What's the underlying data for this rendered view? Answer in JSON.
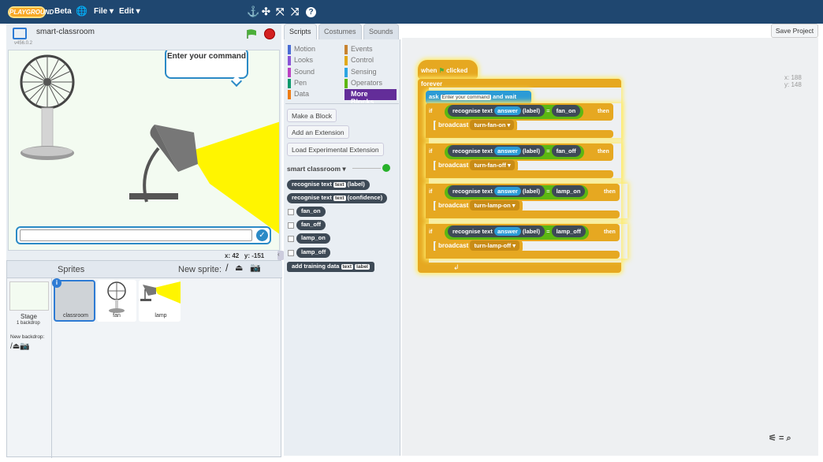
{
  "app": {
    "logo": "PLAYGROUND",
    "beta": "Beta",
    "file": "File ▾",
    "edit": "Edit ▾",
    "version": "v456.0.2"
  },
  "stage": {
    "title": "smart-classroom",
    "speech": "Enter your command",
    "coords_x": "x: 42",
    "coords_y": "y: -151"
  },
  "sprites": {
    "header": "Sprites",
    "new_sprite": "New sprite:",
    "stage_label": "Stage",
    "stage_sub": "1 backdrop",
    "new_backdrop": "New backdrop:",
    "items": [
      {
        "name": "classroom"
      },
      {
        "name": "fan"
      },
      {
        "name": "lamp"
      }
    ]
  },
  "tabs": [
    "Scripts",
    "Costumes",
    "Sounds"
  ],
  "categories": [
    {
      "label": "Motion",
      "color": "#4a6cd4"
    },
    {
      "label": "Events",
      "color": "#c88330"
    },
    {
      "label": "Looks",
      "color": "#8a55d7"
    },
    {
      "label": "Control",
      "color": "#e1a91a"
    },
    {
      "label": "Sound",
      "color": "#bb42c3"
    },
    {
      "label": "Sensing",
      "color": "#2ca5e2"
    },
    {
      "label": "Pen",
      "color": "#0e9a6c"
    },
    {
      "label": "Operators",
      "color": "#5cb712"
    },
    {
      "label": "Data",
      "color": "#ee7d16"
    },
    {
      "label": "More Blocks",
      "color": "#632d99"
    }
  ],
  "palette": {
    "make_block": "Make a Block",
    "add_ext": "Add an Extension",
    "load_exp": "Load Experimental Extension",
    "ext_name": "smart classroom ▾",
    "blocks": {
      "rec_label": "recognise text",
      "text": "text",
      "label_suffix": "(label)",
      "confidence": "(confidence)",
      "fan_on": "fan_on",
      "fan_off": "fan_off",
      "lamp_on": "lamp_on",
      "lamp_off": "lamp_off",
      "add_training": "add training data",
      "label": "label"
    }
  },
  "scripts": {
    "project": "smart classroom",
    "save": "Save Project",
    "xy_x": "x: 188",
    "xy_y": "y: 148",
    "when": "when",
    "clicked": "clicked",
    "forever": "forever",
    "ask": "ask",
    "ask_text": "Enter your command",
    "and_wait": "and wait",
    "if": "if",
    "then": "then",
    "recognise": "recognise text",
    "answer": "answer",
    "label": "(label)",
    "eq": "=",
    "broadcast": "broadcast",
    "rows": [
      {
        "cmp": "fan_on",
        "msg": "turn-fan-on ▾"
      },
      {
        "cmp": "fan_off",
        "msg": "turn-fan-off ▾"
      },
      {
        "cmp": "lamp_on",
        "msg": "turn-lamp-on ▾"
      },
      {
        "cmp": "lamp_off",
        "msg": "turn-lamp-off ▾"
      }
    ]
  }
}
